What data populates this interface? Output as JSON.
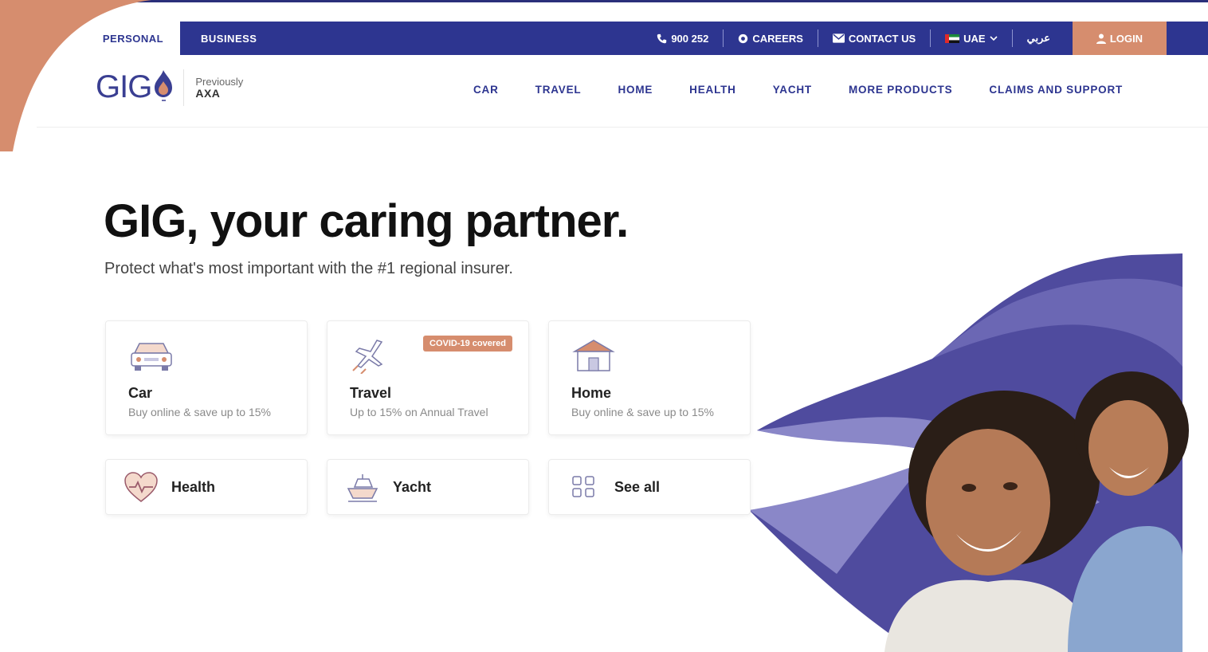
{
  "utility_bar": {
    "segment_tabs": [
      {
        "label": "PERSONAL",
        "active": true
      },
      {
        "label": "BUSINESS",
        "active": false
      }
    ],
    "phone": "900 252",
    "careers": "CAREERS",
    "contact": "CONTACT US",
    "region": "UAE",
    "language": "عربي",
    "login": "LOGIN"
  },
  "logo": {
    "brand": "GIG",
    "previously": "Previously",
    "former_brand": "AXA"
  },
  "nav": {
    "links": [
      "CAR",
      "TRAVEL",
      "HOME",
      "HEALTH",
      "YACHT",
      "MORE PRODUCTS",
      "CLAIMS AND SUPPORT"
    ]
  },
  "hero": {
    "title": "GIG, your caring partner.",
    "subtitle": "Protect what's most important with the #1 regional insurer."
  },
  "products": {
    "car": {
      "title": "Car",
      "desc": "Buy online & save up to 15%",
      "icon": "car-icon"
    },
    "travel": {
      "title": "Travel",
      "desc": "Up to 15% on Annual Travel",
      "badge": "COVID-19 covered",
      "icon": "plane-icon"
    },
    "home": {
      "title": "Home",
      "desc": "Buy online & save up to 15%",
      "icon": "house-icon"
    },
    "health": {
      "title": "Health",
      "icon": "heart-icon"
    },
    "yacht": {
      "title": "Yacht",
      "icon": "yacht-icon"
    },
    "see_all": {
      "title": "See all",
      "icon": "grid-icon"
    }
  },
  "colors": {
    "brand_navy": "#2d3590",
    "accent_copper": "#d68d6e",
    "lavender": "#8a87c8"
  }
}
